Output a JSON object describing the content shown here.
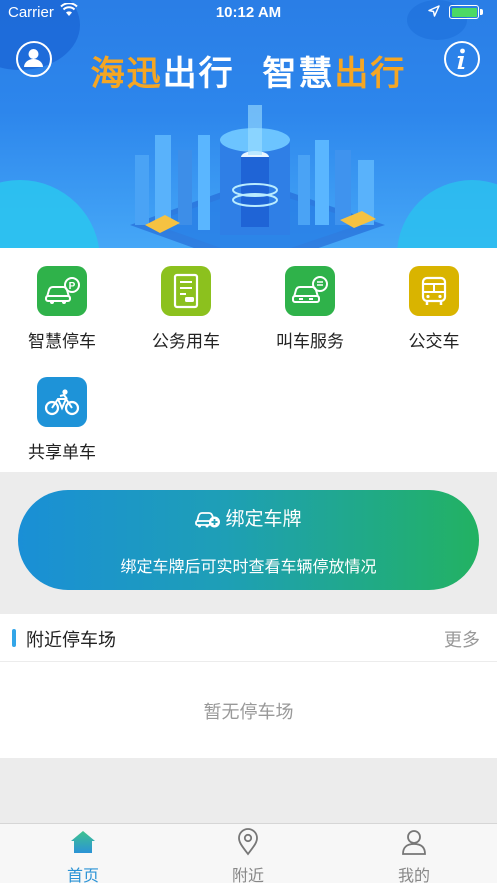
{
  "status_bar": {
    "carrier": "Carrier",
    "time": "10:12 AM"
  },
  "hero": {
    "title_part1": "海迅",
    "title_part2": "出行",
    "title_part3": "智慧",
    "title_part4": "出行"
  },
  "services": [
    {
      "label": "智慧停车",
      "icon": "smart-parking-icon",
      "color": "#2fb24a"
    },
    {
      "label": "公务用车",
      "icon": "official-car-icon",
      "color": "#8cc11e"
    },
    {
      "label": "叫车服务",
      "icon": "taxi-service-icon",
      "color": "#2fb24a"
    },
    {
      "label": "公交车",
      "icon": "bus-icon",
      "color": "#d9b400"
    },
    {
      "label": "共享单车",
      "icon": "bike-icon",
      "color": "#1e93d8"
    }
  ],
  "bind_banner": {
    "title": "绑定车牌",
    "subtitle": "绑定车牌后可实时查看车辆停放情况"
  },
  "nearby": {
    "title": "附近停车场",
    "more": "更多",
    "empty": "暂无停车场"
  },
  "tabs": [
    {
      "label": "首页",
      "icon": "home-icon",
      "active": true,
      "color": "#2b93d6"
    },
    {
      "label": "附近",
      "icon": "location-pin-icon",
      "active": false,
      "color": "#888888"
    },
    {
      "label": "我的",
      "icon": "profile-icon",
      "active": false,
      "color": "#888888"
    }
  ]
}
